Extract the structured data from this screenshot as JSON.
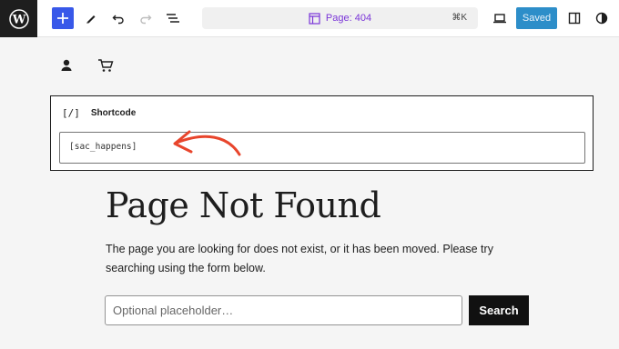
{
  "toolbar": {
    "document_title": "Page: 404",
    "shortcut": "⌘K",
    "saved_label": "Saved",
    "icons": [
      "wordpress-logo",
      "plus-icon",
      "pencil-icon",
      "undo-icon",
      "redo-icon",
      "list-view-icon",
      "page-icon",
      "desktop-preview-icon",
      "sidebar-toggle-icon",
      "styles-icon"
    ],
    "accent_color": "#3858e9",
    "saved_color": "#2d8ec9"
  },
  "header": {
    "icons": [
      "user-icon",
      "cart-icon"
    ]
  },
  "shortcode_block": {
    "icon_text": "[/]",
    "label": "Shortcode",
    "value": "[sac_happens]",
    "annotation_color": "#e8452c"
  },
  "content": {
    "title": "Page Not Found",
    "description": "The page you are looking for does not exist, or it has been moved. Please try searching using the form below.",
    "search_placeholder": "Optional placeholder…",
    "search_button": "Search"
  }
}
